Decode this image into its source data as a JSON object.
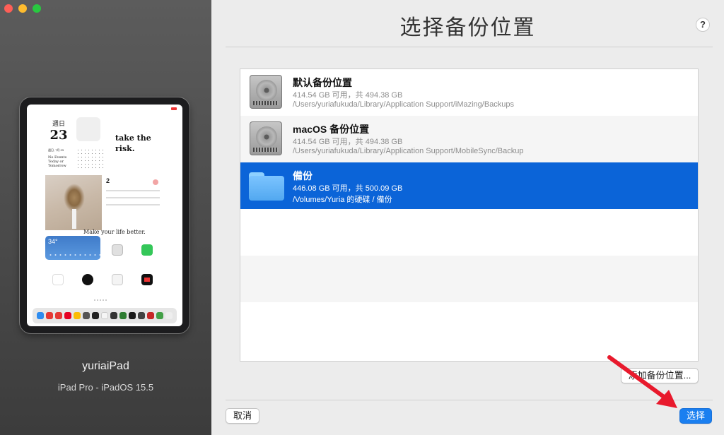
{
  "window": {
    "title": "选择备份位置",
    "help_label": "?"
  },
  "device": {
    "name": "yuriaiPad",
    "model": "iPad Pro - iPadOS 15.5"
  },
  "ipad_screen": {
    "weekday": "週日",
    "day": "23",
    "quote": "take the risk.",
    "calendar_header": "週日, 7月 23",
    "calendar_status": "No Events Today or Tomorrow",
    "todo_count": "2",
    "quote2": "Make your life better.",
    "temperature": "34°"
  },
  "backup_locations": [
    {
      "name": "默认备份位置",
      "size": "414.54 GB 可用，共 494.38 GB",
      "path": "/Users/yuriafukuda/Library/Application Support/iMazing/Backups",
      "icon": "hard-drive-icon",
      "selected": false
    },
    {
      "name": "macOS 备份位置",
      "size": "414.54 GB 可用，共 494.38 GB",
      "path": "/Users/yuriafukuda/Library/Application Support/MobileSync/Backup",
      "icon": "hard-drive-icon",
      "selected": false
    },
    {
      "name": "備份",
      "size": "446.08 GB 可用，共 500.09 GB",
      "path": "/Volumes/Yuria 的硬碟 / 備份",
      "icon": "folder-icon",
      "selected": true
    }
  ],
  "buttons": {
    "add_location": "添加备份位置...",
    "cancel": "取消",
    "select": "选择"
  },
  "colors": {
    "selection": "#0b64d8",
    "primary_button": "#1a7ff0",
    "annotation_arrow": "#e8192c"
  }
}
